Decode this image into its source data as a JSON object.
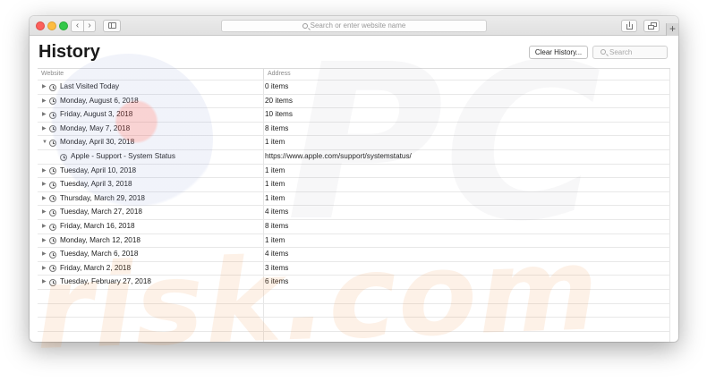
{
  "toolbar": {
    "back_icon": "chevron-left-icon",
    "forward_icon": "chevron-right-icon",
    "sidebar_icon": "sidebar-icon",
    "url_placeholder": "Search or enter website name",
    "share_icon": "share-icon",
    "tabs_icon": "tabs-overview-icon",
    "new_tab_label": "+"
  },
  "page": {
    "title": "History",
    "clear_history_label": "Clear History...",
    "search_placeholder": "Search"
  },
  "table": {
    "columns": [
      "Website",
      "Address"
    ],
    "rows": [
      {
        "website": "Last Visited Today",
        "address": "0 items",
        "expanded": false,
        "child": false
      },
      {
        "website": "Monday, August 6, 2018",
        "address": "20 items",
        "expanded": false,
        "child": false
      },
      {
        "website": "Friday, August 3, 2018",
        "address": "10 items",
        "expanded": false,
        "child": false
      },
      {
        "website": "Monday, May 7, 2018",
        "address": "8 items",
        "expanded": false,
        "child": false
      },
      {
        "website": "Monday, April 30, 2018",
        "address": "1 item",
        "expanded": true,
        "child": false
      },
      {
        "website": "Apple - Support - System Status",
        "address": "https://www.apple.com/support/systemstatus/",
        "expanded": false,
        "child": true
      },
      {
        "website": "Tuesday, April 10, 2018",
        "address": "1 item",
        "expanded": false,
        "child": false
      },
      {
        "website": "Tuesday, April 3, 2018",
        "address": "1 item",
        "expanded": false,
        "child": false
      },
      {
        "website": "Thursday, March 29, 2018",
        "address": "1 item",
        "expanded": false,
        "child": false
      },
      {
        "website": "Tuesday, March 27, 2018",
        "address": "4 items",
        "expanded": false,
        "child": false
      },
      {
        "website": "Friday, March 16, 2018",
        "address": "8 items",
        "expanded": false,
        "child": false
      },
      {
        "website": "Monday, March 12, 2018",
        "address": "1 item",
        "expanded": false,
        "child": false
      },
      {
        "website": "Tuesday, March 6, 2018",
        "address": "4 items",
        "expanded": false,
        "child": false
      },
      {
        "website": "Friday, March 2, 2018",
        "address": "3 items",
        "expanded": false,
        "child": false
      },
      {
        "website": "Tuesday, February 27, 2018",
        "address": "6 items",
        "expanded": false,
        "child": false
      }
    ],
    "empty_rows": 4
  },
  "watermark": {
    "text": "risk.com",
    "prefix": "PC",
    "color": "#ec8c3c"
  },
  "colors": {
    "close": "#fc605c",
    "minimize": "#fdbc40",
    "maximize": "#34c84a"
  }
}
